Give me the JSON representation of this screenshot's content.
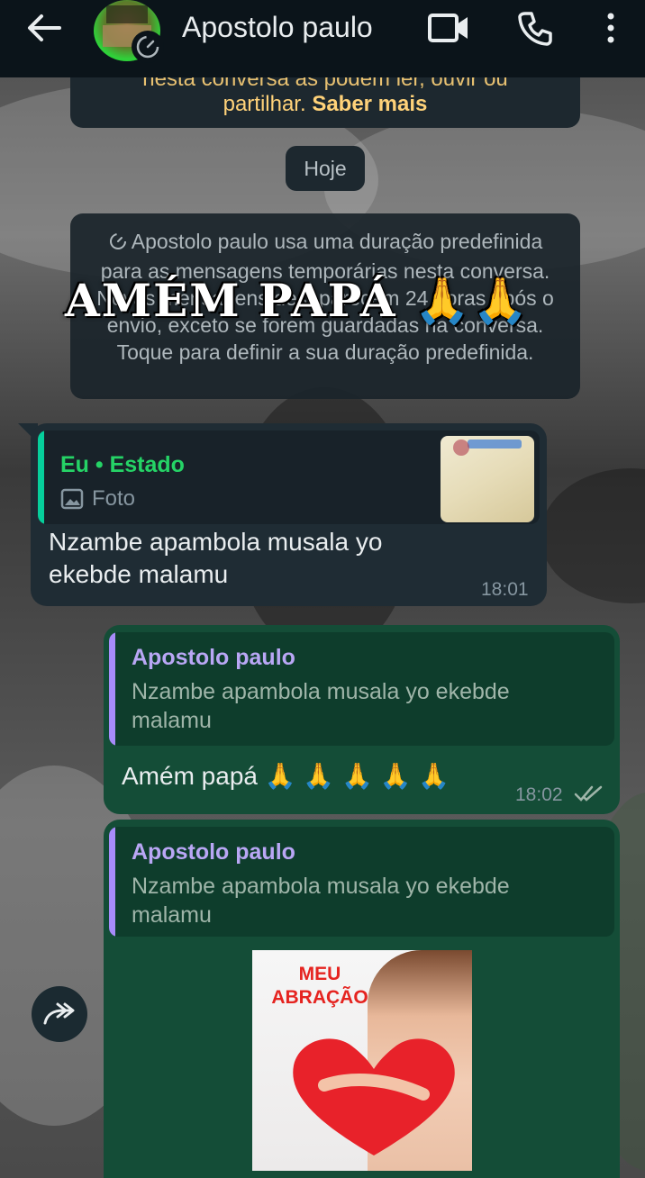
{
  "header": {
    "contact_name": "Apostolo paulo",
    "icons": [
      "back-arrow-icon",
      "video-call-icon",
      "phone-icon",
      "more-vert-icon"
    ]
  },
  "system_top": {
    "line1": "nesta conversa as podem ler, ouvir ou",
    "line2_prefix": "partilhar. ",
    "learn_more": "Saber mais"
  },
  "date_chip": "Hoje",
  "disappearing_notice": "Apostolo paulo usa uma duração predefinida para as mensagens temporárias nesta conversa. Novas mensagens desaparecem 24 horas após o envio, exceto se forem guardadas na conversa. Toque para definir a sua duração predefinida.",
  "overlay_text": "AMÉM PAPÁ 🙏🙏",
  "messages": [
    {
      "direction": "incoming",
      "quote": {
        "author": "Eu • Estado",
        "type_label": "Foto"
      },
      "text_line1": "Nzambe apambola musala yo",
      "text_line2": "ekebde malamu",
      "time": "18:01"
    },
    {
      "direction": "outgoing",
      "quote": {
        "author": "Apostolo paulo",
        "text": "Nzambe apambola musala yo ekebde malamu"
      },
      "text": "Amém papá 🙏 🙏 🙏 🙏 🙏",
      "time": "18:02",
      "status": "read"
    },
    {
      "direction": "outgoing",
      "quote": {
        "author": "Apostolo paulo",
        "text": "Nzambe apambola musala yo ekebde malamu"
      },
      "sticker_text": "MEU ABRAÇÃO"
    }
  ],
  "colors": {
    "header_bg": "#0b141a",
    "incoming_bg": "#1f2c34",
    "outgoing_bg": "#144d37",
    "accent_green": "#25d366",
    "quote_author_purple": "#b9a7f5"
  }
}
